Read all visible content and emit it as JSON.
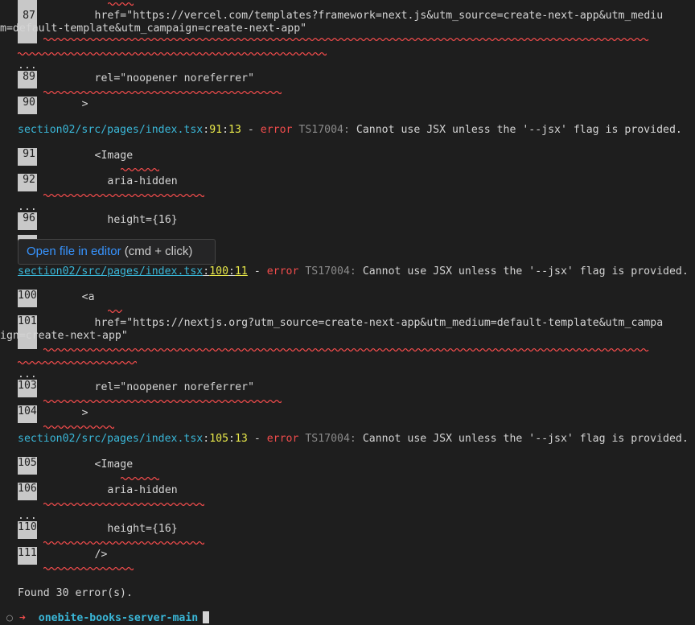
{
  "lines": {
    "l87": {
      "num": "87",
      "text": "        href=\"https://vercel.com/templates?framework=next.js&utm_source=create-next-app&utm_mediu"
    },
    "l87b": {
      "text": "m=default-template&utm_campaign=create-next-app\""
    },
    "l89": {
      "num": "89",
      "text": "        rel=\"noopener noreferrer\""
    },
    "l90": {
      "num": "90",
      "text": "      >"
    },
    "l91": {
      "num": "91",
      "text": "        <Image"
    },
    "l92": {
      "num": "92",
      "text": "          aria-hidden"
    },
    "l96": {
      "num": "96",
      "text": "          height={16}"
    },
    "l100": {
      "num": "100",
      "text": "      <a"
    },
    "l101": {
      "num": "101",
      "text": "        href=\"https://nextjs.org?utm_source=create-next-app&utm_medium=default-template&utm_campa"
    },
    "l101b": {
      "text": "ign=create-next-app\""
    },
    "l103": {
      "num": "103",
      "text": "        rel=\"noopener noreferrer\""
    },
    "l104": {
      "num": "104",
      "text": "      >"
    },
    "l105": {
      "num": "105",
      "text": "        <Image"
    },
    "l106": {
      "num": "106",
      "text": "          aria-hidden"
    },
    "l110": {
      "num": "110",
      "text": "          height={16}"
    },
    "l111": {
      "num": "111",
      "text": "        />"
    }
  },
  "errors": [
    {
      "path": "section02/src/pages/index.tsx",
      "line": "91",
      "col": "13",
      "word": "error",
      "code": "TS17004:",
      "msg": "Cannot use JSX unless the '--jsx' flag is provided."
    },
    {
      "path": "section02/src/pages/index.tsx",
      "line": "100",
      "col": "11",
      "word": "error",
      "code": "TS17004:",
      "msg": "Cannot use JSX unless the '--jsx' flag is provided."
    },
    {
      "path": "section02/src/pages/index.tsx",
      "line": "105",
      "col": "13",
      "word": "error",
      "code": "TS17004:",
      "msg": "Cannot use JSX unless the '--jsx' flag is provided."
    }
  ],
  "ellipsis": "...",
  "tooltip": {
    "link": "Open file in editor",
    "hint": "(cmd + click)"
  },
  "summary": "Found 30 error(s).",
  "prompt": {
    "circle": "○",
    "arrow": "➜",
    "dir": "onebite-books-server-main"
  },
  "colors": {
    "background": "#1e1e1e",
    "path": "#3ab7d8",
    "line_number": "#e8e84a",
    "error": "#f14c4c",
    "squiggle": "#f14c4c",
    "link": "#3794ff"
  }
}
